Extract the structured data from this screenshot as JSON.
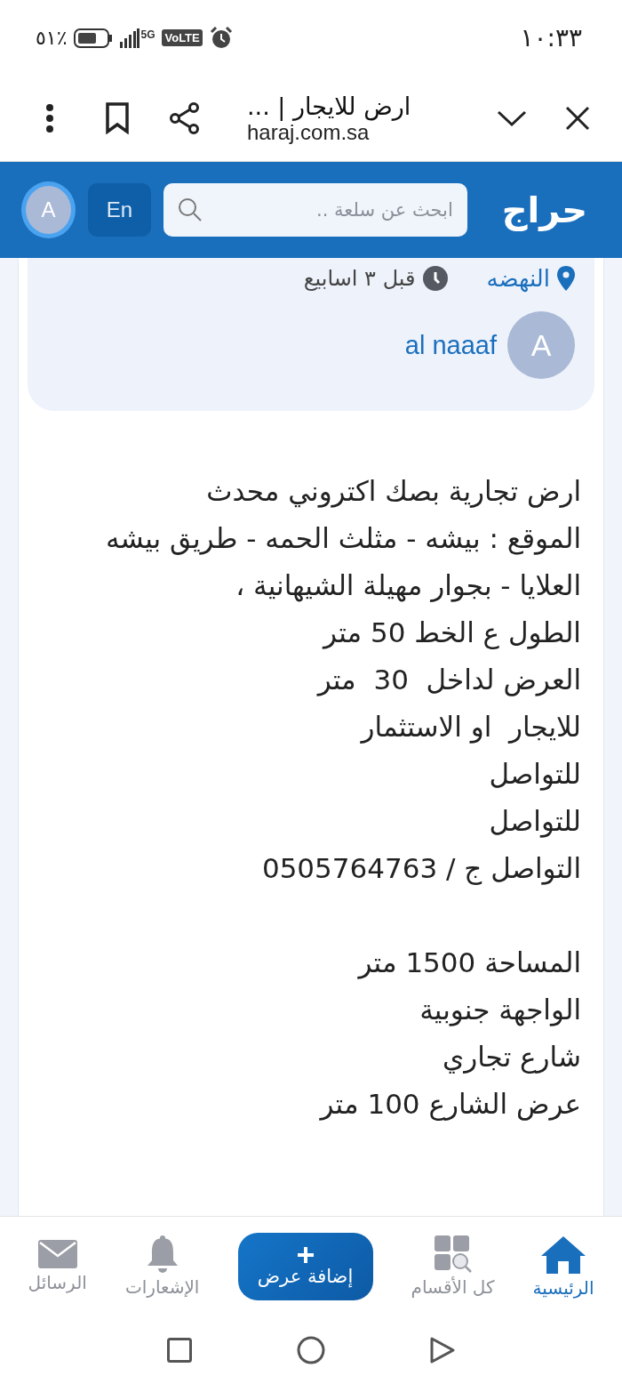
{
  "status_bar": {
    "time": "١٠:٣٣",
    "network": "5G",
    "volte": "VoLTE",
    "battery_percent": "٪٥١"
  },
  "browser_bar": {
    "title": "ارض للايجار | ...",
    "url": "haraj.com.sa"
  },
  "header": {
    "logo": "حراج",
    "search": {
      "placeholder": "ابحث عن سلعة .."
    },
    "language_button": "En",
    "avatar": "A"
  },
  "post_meta": {
    "location": "النهضه",
    "time": "قبل ٣ اسابيع",
    "seller": {
      "avatar": "A",
      "name": "al naaaf"
    }
  },
  "description": [
    {
      "lines": [
        "ارض تجارية بصك اكتروني محدث",
        "الموقع : بيشه - مثلث الحمه - طريق بيشه",
        "العلايا - بجوار مهيلة الشيهانية ،",
        "الطول ع الخط 50 متر",
        "العرض لداخل  30  متر",
        "للايجار  او الاستثمار",
        "للتواصل",
        "للتواصل",
        "التواصل ج / 0505764763"
      ]
    },
    {
      "lines": [
        "المساحة 1500 متر",
        "الواجهة جنوبية",
        "شارع تجاري",
        "عرض الشارع 100 متر"
      ]
    }
  ],
  "bottom_nav": [
    {
      "kind": "home",
      "label": "الرئيسية",
      "selected": true
    },
    {
      "kind": "categories",
      "label": "كل الأقسام",
      "selected": false
    },
    {
      "kind": "add",
      "label": "إضافة عرض",
      "selected": false
    },
    {
      "kind": "notifications",
      "label": "الإشعارات",
      "selected": false
    },
    {
      "kind": "messages",
      "label": "الرسائل",
      "selected": false
    }
  ]
}
